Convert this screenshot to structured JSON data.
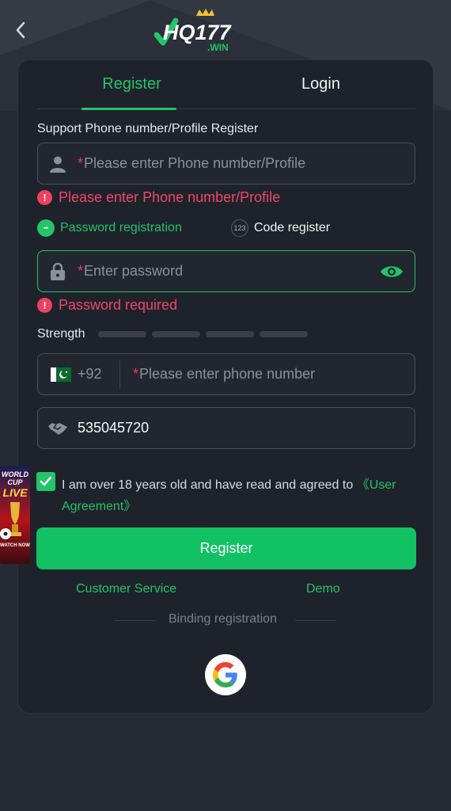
{
  "header": {
    "back_icon": "chevron-left-icon",
    "logo_text": "HQ177",
    "logo_sub": ".WIN"
  },
  "tabs": [
    {
      "label": "Register",
      "active": true
    },
    {
      "label": "Login",
      "active": false
    }
  ],
  "form": {
    "support_label": "Support Phone number/Profile Register",
    "profile": {
      "required_mark": "*",
      "placeholder": "Please enter Phone number/Profile",
      "value": ""
    },
    "profile_error": "Please enter Phone number/Profile",
    "modes": {
      "password": {
        "label": "Password registration",
        "selected": true,
        "icon_text": "••"
      },
      "code": {
        "label": "Code register",
        "selected": false,
        "icon_text": "123"
      }
    },
    "password": {
      "required_mark": "*",
      "placeholder": "Enter password",
      "value": ""
    },
    "password_error": "Password required",
    "strength_label": "Strength",
    "strength_level": 0,
    "phone": {
      "country_code": "+92",
      "required_mark": "*",
      "placeholder": "Please enter phone number",
      "value": ""
    },
    "invite_code": "535045720",
    "agreement": {
      "checked": true,
      "text": "I am over 18 years old and have read and agreed to ",
      "link_text": "《User Agreement》"
    },
    "register_button": "Register",
    "customer_service": "Customer Service",
    "demo": "Demo",
    "binding_label": "Binding registration"
  },
  "promo": {
    "line1": "WORLD",
    "line2": "CUP",
    "line3": "LIVE",
    "cta": "WATCH NOW"
  },
  "colors": {
    "accent": "#23c46a",
    "error": "#f04767",
    "card": "#1e222b",
    "background": "#262a35"
  }
}
